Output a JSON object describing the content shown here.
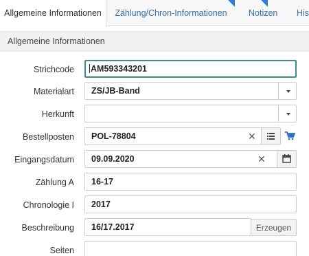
{
  "tabs": [
    {
      "label": "Allgemeine Informationen",
      "active": true
    },
    {
      "label": "Zählung/Chron-Informationen"
    },
    {
      "label": "Notizen"
    },
    {
      "label": "His"
    }
  ],
  "section": {
    "title": "Allgemeine Informationen"
  },
  "fields": {
    "strichcode": {
      "label": "Strichcode",
      "value": "AM593343201"
    },
    "materialart": {
      "label": "Materialart",
      "value": "ZS/JB-Band"
    },
    "herkunft": {
      "label": "Herkunft",
      "value": ""
    },
    "bestellposten": {
      "label": "Bestellposten",
      "value": "POL-78804"
    },
    "eingangsdatum": {
      "label": "Eingangsdatum",
      "value": "09.09.2020"
    },
    "zaehlung_a": {
      "label": "Zählung A",
      "value": "16-17"
    },
    "chronologie_i": {
      "label": "Chronologie I",
      "value": "2017"
    },
    "beschreibung": {
      "label": "Beschreibung",
      "value": "16/17.2017",
      "button": "Erzeugen"
    },
    "seiten": {
      "label": "Seiten",
      "value": ""
    }
  },
  "colors": {
    "accent": "#2f7fd0",
    "focus_border": "#3c8c8e",
    "link": "#3a6ea5"
  }
}
